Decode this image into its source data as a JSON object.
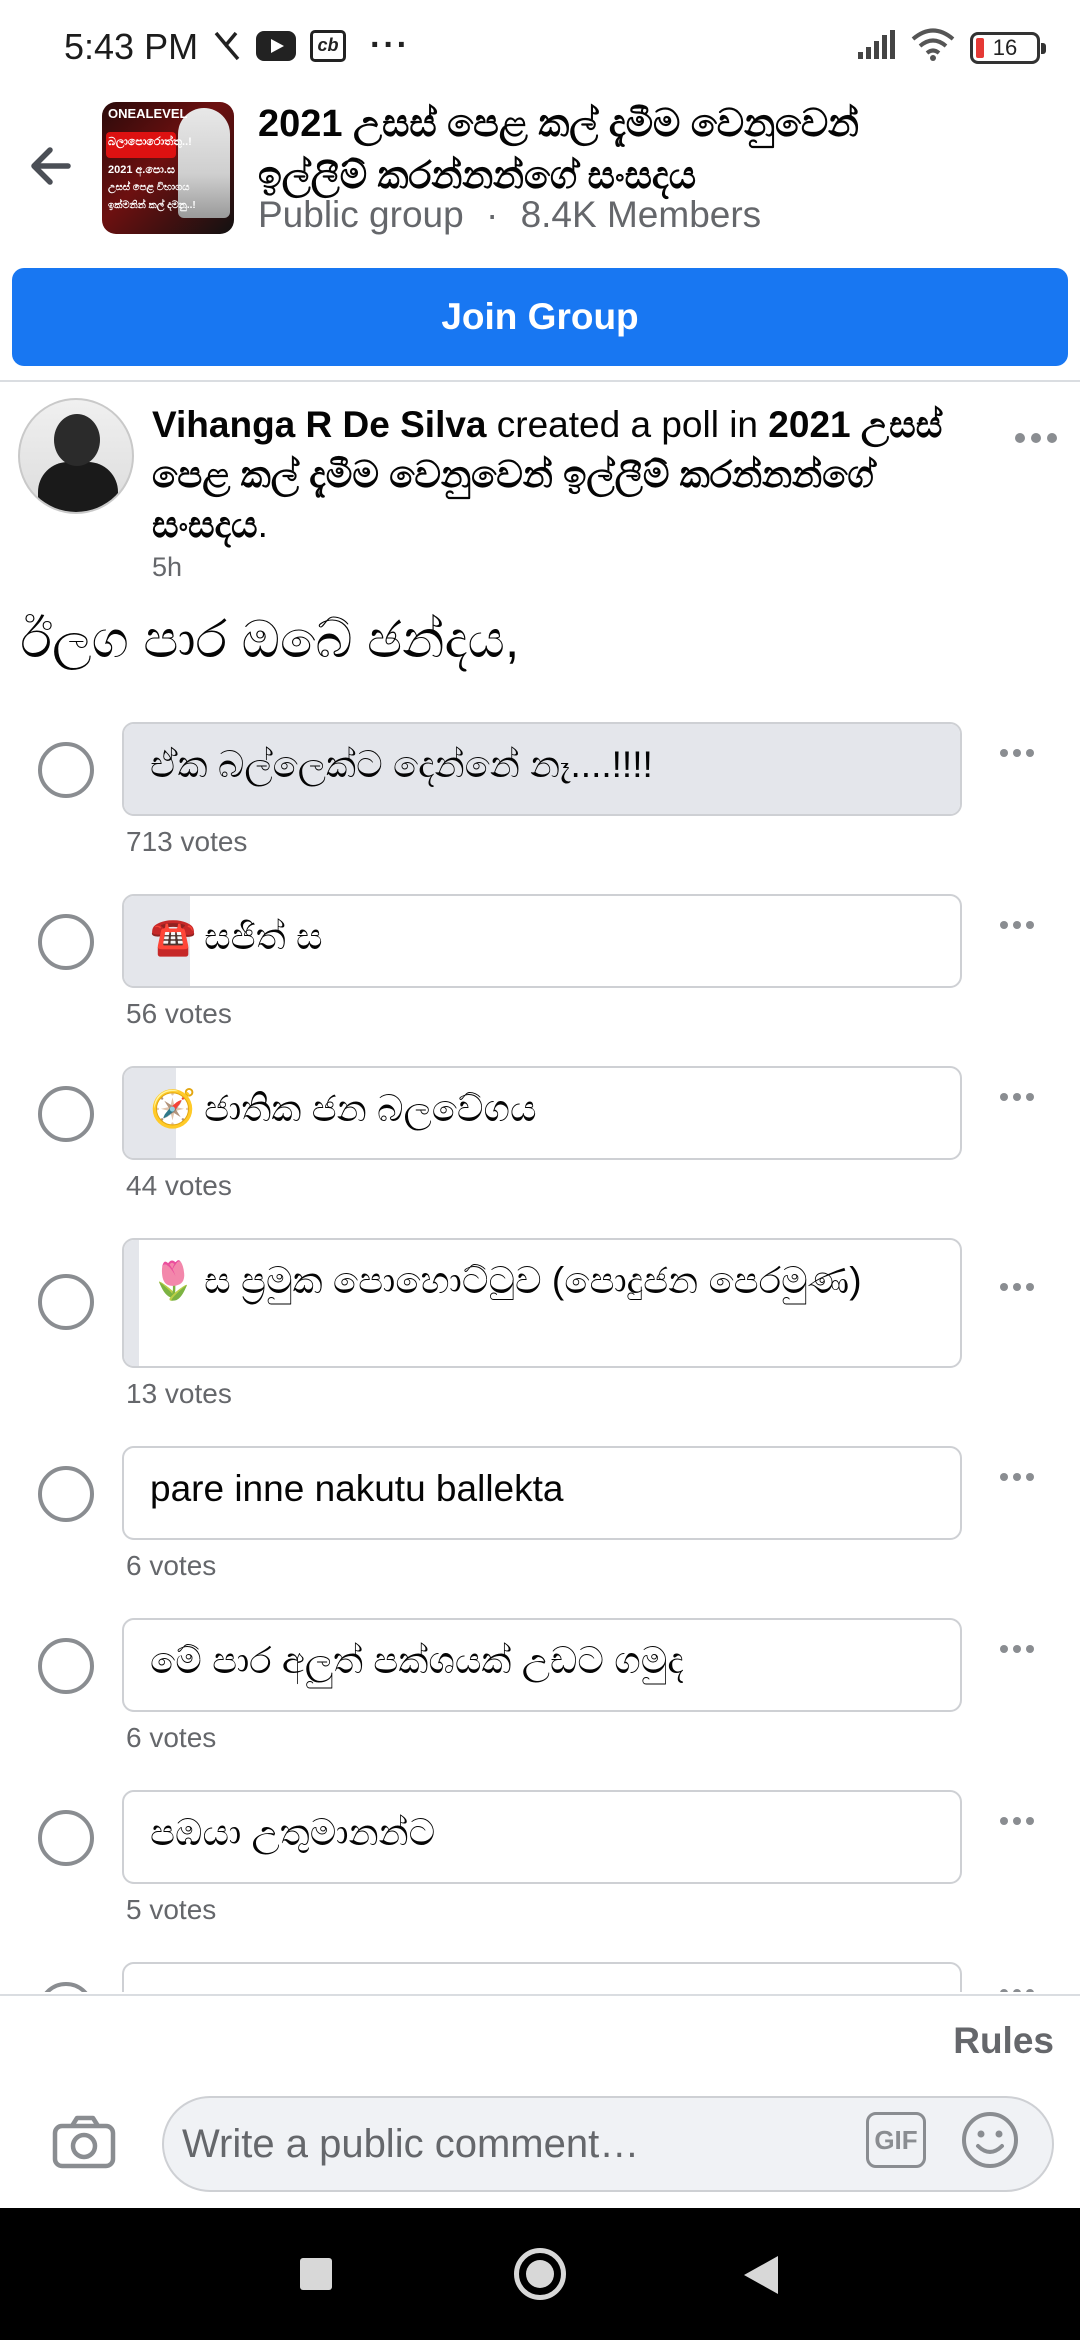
{
  "status_bar": {
    "time": "5:43 PM",
    "left_icons": [
      "missed-call-icon",
      "youtube-icon",
      "cb-icon",
      "more-notifications-icon"
    ],
    "cb_label": "cb",
    "more_label": "···",
    "battery_level": "16"
  },
  "header": {
    "group_name": "2021 උසස් පෙළ කල් දැමීම වෙනුවෙන් ඉල්ලීම් කරන්නන්ගේ සංසදය",
    "privacy": "Public group",
    "separator": "·",
    "members": "8.4K Members",
    "thumbnail_lines": [
      "ONEALEVEL",
      "බලාපොරොත්තු..!",
      "2021 අ.පො.ස",
      "උසස් පෙළ විභාගය",
      "ඉක්මනින් කල් දමනු..!"
    ]
  },
  "join_button": {
    "label": "Join Group"
  },
  "post": {
    "author": "Vihanga R De Silva",
    "action": "created a poll in",
    "group": "2021 උසස් පෙළ කල් දැමීම වෙනුවෙන් ඉල්ලීම් කරන්නන්ගේ සංසදය",
    "end": ".",
    "time": "5h",
    "question": "ඊලග පාර ඔබේ ඡන්දය,"
  },
  "poll": {
    "options": [
      {
        "label": "ඒක බල්ලෙක්ට දෙන්නේ නෑ....!!!!",
        "emoji": "",
        "votes": "713 votes",
        "fill": 1.0
      },
      {
        "label": "සජිත් ස",
        "emoji": "☎️",
        "votes": "56 votes",
        "fill": 0.079
      },
      {
        "label": "ජාතික ජන බලවේගය",
        "emoji": "🧭",
        "votes": "44 votes",
        "fill": 0.062
      },
      {
        "label": "ස ප්‍රමුක පොහොට්ටුව (පොදුජන පෙරමුණ)",
        "emoji": "🌷",
        "votes": "13 votes",
        "fill": 0.018
      },
      {
        "label": "pare inne nakutu ballekta",
        "emoji": "",
        "votes": "6 votes",
        "fill": 0.0
      },
      {
        "label": "මේ පාර අලුත් පක්ශයක් උඩට ගමුද",
        "emoji": "",
        "votes": "6 votes",
        "fill": 0.0
      },
      {
        "label": "පඹයා උතුමානන්ට",
        "emoji": "",
        "votes": "5 votes",
        "fill": 0.0
      },
      {
        "label": "",
        "emoji": "",
        "votes": "",
        "fill": 0.0
      }
    ]
  },
  "comment_bar": {
    "rules": "Rules",
    "placeholder": "Write a public comment…",
    "gif_label": "GIF"
  },
  "colors": {
    "brand_blue": "#1877f2",
    "text_secondary": "#65676b",
    "poll_fill": "#e4e6eb"
  }
}
